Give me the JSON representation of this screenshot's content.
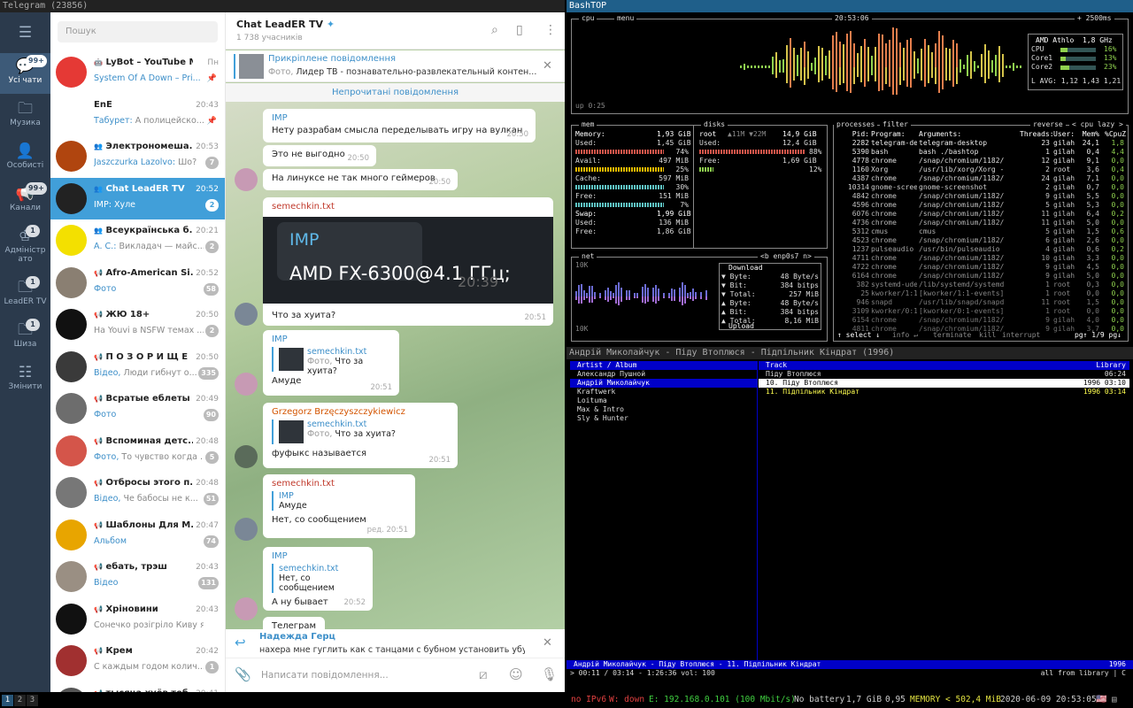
{
  "tg_window_title": "Telegram (23856)",
  "rail": [
    {
      "icon": "menu-icon",
      "label": ""
    },
    {
      "label": "Усі чати",
      "badge": "99+"
    },
    {
      "label": "Музика",
      "badge": ""
    },
    {
      "label": "Особисті",
      "badge": ""
    },
    {
      "label": "Канали",
      "badge": "99+"
    },
    {
      "label": "Адміністр\nато",
      "badge": "1"
    },
    {
      "label": "LeadER TV",
      "badge": "1"
    },
    {
      "label": "Шиза",
      "badge": "1"
    },
    {
      "label": "Змінити",
      "badge": ""
    }
  ],
  "search_placeholder": "Пошук",
  "chats": [
    {
      "name": "LyBot – YouTube M...",
      "time": "Пн",
      "who": "System Of A Down – Pri...",
      "text": "",
      "badge": ""
    },
    {
      "name": "EnE",
      "time": "20:43",
      "who": "Табурет:",
      "text": "А полицейско...",
      "badge": ""
    },
    {
      "name": "Электрономеша...",
      "time": "20:53",
      "who": "Jaszczurka Lazolvo:",
      "text": "Шо?",
      "badge": "7"
    },
    {
      "name": "Chat LeadER TV",
      "time": "20:52",
      "who": "IMP:",
      "text": "Хуле",
      "badge": "2"
    },
    {
      "name": "Всеукраїнська б...",
      "time": "20:21",
      "who": "А. С.:",
      "text": "Викладач — майс...",
      "badge": "2"
    },
    {
      "name": "Afro-American Si...",
      "time": "20:52",
      "who": "Фото",
      "text": "",
      "badge": "58"
    },
    {
      "name": "ЖЮ 18+",
      "time": "20:50",
      "who": "",
      "text": "На Youvi в NSFW темах ...",
      "badge": "2"
    },
    {
      "name": "П О З О Р И Щ Е",
      "time": "20:50",
      "who": "Відео,",
      "text": "Люди гибнут о...",
      "badge": "335"
    },
    {
      "name": "Всратые еблеты ...",
      "time": "20:49",
      "who": "Фото",
      "text": "",
      "badge": "90"
    },
    {
      "name": "Вспоминая детс...",
      "time": "20:48",
      "who": "Фото,",
      "text": "То чувство когда ...",
      "badge": "5"
    },
    {
      "name": "Отбросы этого п...",
      "time": "20:48",
      "who": "Відео,",
      "text": "Че бабосы не к...",
      "badge": "51"
    },
    {
      "name": "Шаблоны Для М...",
      "time": "20:47",
      "who": "Альбом",
      "text": "",
      "badge": "74"
    },
    {
      "name": "ебать, трэш",
      "time": "20:43",
      "who": "Відео",
      "text": "",
      "badge": "131"
    },
    {
      "name": "Хріновини",
      "time": "20:43",
      "who": "",
      "text": "Сонечко розігріло Киву як ...",
      "badge": ""
    },
    {
      "name": "Крем",
      "time": "20:42",
      "who": "",
      "text": "С каждым годом колич...",
      "badge": "1"
    },
    {
      "name": "тысяча хуёв теб...",
      "time": "20:41",
      "who": "",
      "text": "",
      "badge": ""
    }
  ],
  "chat_header": {
    "title": "Chat LeadER TV",
    "subtitle": "1 738 учасників"
  },
  "pinned": {
    "label": "Прикріплене повідомлення",
    "type": "Фото,",
    "text": "Лидер ТВ - познавательно-развлекательный контен..."
  },
  "unread_label": "Непрочитані повідомлення",
  "messages": {
    "m1": {
      "name": "IMP",
      "text": "Нету разрабам смысла переделывать игру на вулкан",
      "time": "20:50"
    },
    "m2": {
      "text": "Это не выгодно",
      "time": "20:50"
    },
    "m3": {
      "text": "На линуксе не так много геймеров",
      "time": "20:50"
    },
    "m4": {
      "name": "semechkin.txt",
      "img_name": "IMP",
      "img_text": "AMD FX-6300@4.1 ГГц;",
      "img_time": "20:39",
      "text": "Что за хуита?",
      "time": "20:51"
    },
    "m5": {
      "name": "IMP",
      "reply_name": "semechkin.txt",
      "reply_type": "Фото,",
      "reply_text": "Что за хуита?",
      "text": "Амуде",
      "time": "20:51"
    },
    "m6": {
      "name": "Grzegorz Brzęczyszczykiewicz",
      "reply_name": "semechkin.txt",
      "reply_type": "Фото,",
      "reply_text": "Что за хуита?",
      "text": "фуфыкс называется",
      "time": "20:51"
    },
    "m7": {
      "name": "semechkin.txt",
      "reply_name": "IMP",
      "reply_text": "Амуде",
      "text": "Нет, со сообщением",
      "time": "ред. 20:51"
    },
    "m8": {
      "name": "IMP",
      "reply_name": "semechkin.txt",
      "reply_text": "Нет, со сообщением",
      "text": "А ну бывает",
      "time": "20:52"
    },
    "m9": {
      "text": "Телеграм"
    }
  },
  "reply_bar": {
    "name": "Надежда Герц",
    "text": "нахера мне гуглить как с танцами с бубном установить убу..."
  },
  "compose_placeholder": "Написати повідомлення...",
  "bashtop": {
    "title": "BashTOP",
    "cpu_label": "cpu",
    "menu_label": "menu",
    "clock": "20:53:06",
    "interval": "+ 2500ms",
    "cpu_model": "AMD Athlo  1,8 GHz",
    "cpu_rows": [
      [
        "CPU",
        "16%"
      ],
      [
        "Core1",
        "13%"
      ],
      [
        "Core2",
        "23%"
      ]
    ],
    "load": "L AVG: 1,12 1,43 1,21",
    "uptime": "up 0:25",
    "mem_label": "mem",
    "disks_label": "disks",
    "mem": [
      [
        "Memory:",
        "1,93 GiB"
      ],
      [
        "Used:",
        "1,45 GiB"
      ],
      [
        "",
        "74%"
      ],
      [
        "Avail:",
        "497 MiB"
      ],
      [
        "",
        "25%"
      ],
      [
        "Cache:",
        "597 MiB"
      ],
      [
        "",
        "30%"
      ],
      [
        "Free:",
        "151 MiB"
      ],
      [
        "",
        "7%"
      ],
      [
        "Swap:",
        "1,99 GiB"
      ],
      [
        "Used:",
        "136 MiB"
      ],
      [
        "Free:",
        "1,86 GiB"
      ]
    ],
    "disk": {
      "name": "root",
      "io": "▲11M ▼22M",
      "size": "14,9 GiB",
      "used_label": "Used:",
      "used": "12,4 GiB",
      "used_pct": "88%",
      "free_label": "Free:",
      "free": "1,69 GiB",
      "free_pct": "12%"
    },
    "net_label": "net",
    "net_iface": "<b enp0s7 n>",
    "net_scale": "10K",
    "net": {
      "down_label": "Download",
      "up_label": "Upload",
      "rows": [
        [
          "▼ Byte:",
          "48 Byte/s"
        ],
        [
          "▼ Bit:",
          "384 bitps"
        ],
        [
          "▼ Total:",
          "257 MiB"
        ],
        [
          "▲ Byte:",
          "48 Byte/s"
        ],
        [
          "▲ Bit:",
          "384 bitps"
        ],
        [
          "▲ Total:",
          "8,16 MiB"
        ]
      ]
    },
    "proc_label": "processes",
    "filter_label": "filter",
    "reverse_label": "reverse",
    "cpu_lazy": "< cpu lazy >",
    "proc_head": [
      "Pid:",
      "Program:",
      "Arguments:",
      "Threads:",
      "User:",
      "Mem%",
      "%CpuZ"
    ],
    "procs": [
      [
        "2282",
        "telegram-deskt",
        "telegram-desktop",
        "23",
        "gilah",
        "24,1",
        "1,8"
      ],
      [
        "5390",
        "bash",
        "bash ./bashtop",
        "1",
        "gilah",
        "0,4",
        "4,4"
      ],
      [
        "4778",
        "chrome",
        "/snap/chromium/1182/",
        "12",
        "gilah",
        "9,1",
        "0,0"
      ],
      [
        "1160",
        "Xorg",
        "/usr/lib/xorg/Xorg -",
        "2",
        "root",
        "3,6",
        "0,4"
      ],
      [
        "4387",
        "chrome",
        "/snap/chromium/1182/",
        "24",
        "gilah",
        "7,1",
        "0,0"
      ],
      [
        "10314",
        "gnome-screensh",
        "gnome-screenshot",
        "2",
        "gilah",
        "0,7",
        "0,0"
      ],
      [
        "4842",
        "chrome",
        "/snap/chromium/1182/",
        "9",
        "gilah",
        "5,5",
        "0,0"
      ],
      [
        "4596",
        "chrome",
        "/snap/chromium/1182/",
        "5",
        "gilah",
        "5,3",
        "0,0"
      ],
      [
        "6076",
        "chrome",
        "/snap/chromium/1182/",
        "11",
        "gilah",
        "6,4",
        "0,2"
      ],
      [
        "4736",
        "chrome",
        "/snap/chromium/1182/",
        "11",
        "gilah",
        "5,0",
        "0,0"
      ],
      [
        "5312",
        "cmus",
        "cmus",
        "5",
        "gilah",
        "1,5",
        "0,6"
      ],
      [
        "4523",
        "chrome",
        "/snap/chromium/1182/",
        "6",
        "gilah",
        "2,6",
        "0,0"
      ],
      [
        "1237",
        "pulseaudio",
        "/usr/bin/pulseaudio",
        "4",
        "gilah",
        "0,6",
        "0,2"
      ],
      [
        "4711",
        "chrome",
        "/snap/chromium/1182/",
        "10",
        "gilah",
        "3,3",
        "0,0"
      ],
      [
        "4722",
        "chrome",
        "/snap/chromium/1182/",
        "9",
        "gilah",
        "4,5",
        "0,0"
      ],
      [
        "6164",
        "chrome",
        "/snap/chromium/1182/",
        "9",
        "gilah",
        "5,0",
        "0,0"
      ],
      [
        "382",
        "systemd-udevd",
        "/lib/systemd/systemd",
        "1",
        "root",
        "0,3",
        "0,0"
      ],
      [
        "25",
        "kworker/1:1-ev",
        "[kworker/1:1-events]",
        "1",
        "root",
        "0,0",
        "0,0"
      ],
      [
        "946",
        "snapd",
        "/usr/lib/snapd/snapd",
        "11",
        "root",
        "1,5",
        "0,0"
      ],
      [
        "3109",
        "kworker/0:1-ev",
        "[kworker/0:1-events]",
        "1",
        "root",
        "0,0",
        "0,0"
      ],
      [
        "6154",
        "chrome",
        "/snap/chromium/1182/",
        "9",
        "gilah",
        "4,0",
        "0,0"
      ],
      [
        "4811",
        "chrome",
        "/snap/chromium/1182/",
        "9",
        "gilah",
        "3,7",
        "0,0"
      ]
    ],
    "proc_foot": "↑ select ↓",
    "proc_info": "info ↵",
    "proc_term": "terminate",
    "proc_kill": "kill",
    "proc_int": "interrupt",
    "proc_page": "pg↑ 1/9 pg↓"
  },
  "cmus": {
    "title": "Андрій Миколайчук - Піду Втоплюся - Підпільник Кіндрат (1996)",
    "left_head": "Artist / Album",
    "right_head": "Track",
    "library": "Library",
    "artists": [
      "Александр Пушной",
      "Андрій Миколайчук",
      "Kraftwerk",
      "Loituma",
      "Max & Intro",
      "Sly & Hunter"
    ],
    "tracks": [
      {
        "t": "Піду Втоплюся",
        "r": "06:24"
      },
      {
        "t": "10. Піду Втоплюся",
        "r": "1996 03:10"
      },
      {
        "t": "11. Підпільник Кіндрат",
        "r": "1996 03:14"
      }
    ],
    "status": "Андрій Миколайчук - Піду Втоплюся - 11. Підпільник Кіндрат",
    "status_year": "1996",
    "pos": "> 00:11 / 03:14 - 1:26:36 vol: 100",
    "mode": "all from library | C"
  },
  "statusbar": {
    "ws": [
      "1",
      "2",
      "3"
    ],
    "ipv6": "no IPv6",
    "wlan": "W: down",
    "eth": "E: 192.168.0.101 (100 Mbit/s)",
    "battery": "No battery",
    "disk": "1,7 GiB",
    "load": "0,95",
    "memory": "MEMORY < 502,4 MiB",
    "datetime": "2020-06-09 20:53:05"
  },
  "colors": {
    "accent": "#419fd9",
    "rail": "#2b3a4c",
    "rail_active": "#3d5a78"
  }
}
